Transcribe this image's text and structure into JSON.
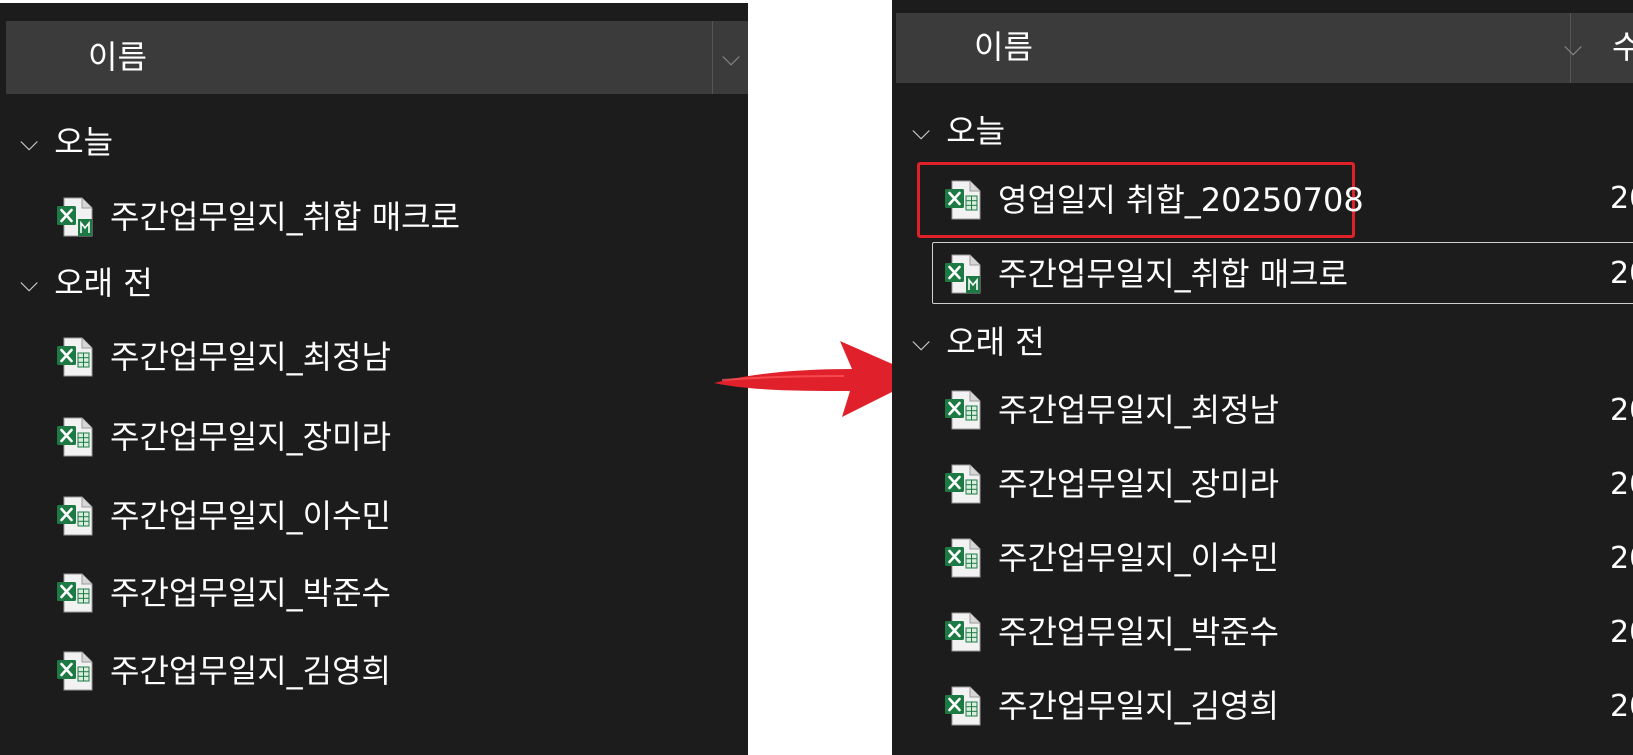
{
  "before": {
    "header": {
      "name_label": "이름"
    },
    "groups": [
      {
        "label": "오늘",
        "files": [
          "주간업무일지_취합 매크로"
        ]
      },
      {
        "label": "오래 전",
        "files": [
          "주간업무일지_최정남",
          "주간업무일지_장미라",
          "주간업무일지_이수민",
          "주간업무일지_박준수",
          "주간업무일지_김영희"
        ]
      }
    ]
  },
  "after": {
    "header": {
      "name_label": "이름",
      "next_column_partial": "수"
    },
    "groups": [
      {
        "label": "오늘",
        "files": [
          "영업일지 취합_20250708",
          "주간업무일지_취합 매크로"
        ]
      },
      {
        "label": "오래 전",
        "files": [
          "주간업무일지_최정남",
          "주간업무일지_장미라",
          "주간업무일지_이수민",
          "주간업무일지_박준수",
          "주간업무일지_김영희"
        ]
      }
    ],
    "date_partial": "20"
  },
  "icons": {
    "file": "excel-file-icon",
    "macro_file": "excel-macro-file-icon",
    "group_toggle": "chevron-down-icon"
  },
  "colors": {
    "pane_bg": "#1c1c1c",
    "header_bg": "#3b3b3b",
    "highlight": "#e0202a",
    "excel_green": "#1d7a45"
  }
}
